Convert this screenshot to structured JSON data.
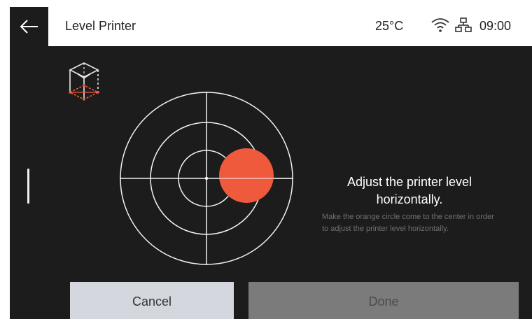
{
  "header": {
    "title": "Level Printer",
    "temperature": "25°C",
    "time": "09:00",
    "icons": [
      "back-arrow-icon",
      "wifi-icon",
      "network-icon"
    ]
  },
  "level_indicator": {
    "bubble_color": "#ef5a3c",
    "ring_color": "#ffffff"
  },
  "message": {
    "title": "Adjust the printer level horizontally.",
    "body": "Make the orange circle come to the center in order to adjust the printer level horizontally."
  },
  "buttons": {
    "cancel": "Cancel",
    "done": "Done"
  },
  "colors": {
    "background": "#1c1c1c",
    "accent": "#ef5a3c",
    "cancel_bg": "#d4d7dd",
    "done_bg": "#7b7b7b"
  }
}
